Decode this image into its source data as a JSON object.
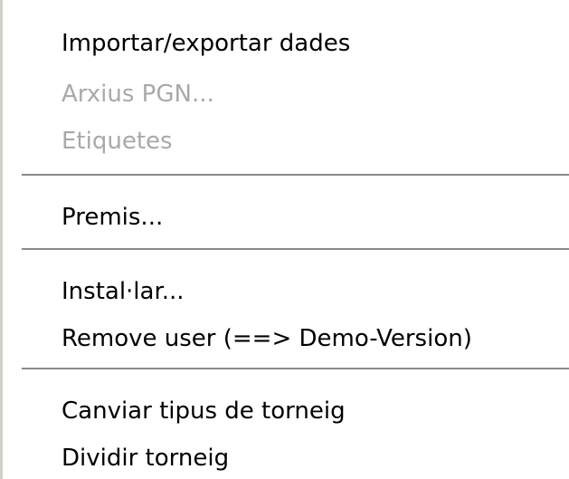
{
  "menu": {
    "items": [
      {
        "label": "Importar/exportar dades",
        "enabled": true
      },
      {
        "label": "Arxius PGN...",
        "enabled": false
      },
      {
        "label": "Etiquetes",
        "enabled": false
      },
      {
        "label": "Premis...",
        "enabled": true
      },
      {
        "label": "Instal·lar...",
        "enabled": true
      },
      {
        "label": "Remove user (==> Demo-Version)",
        "enabled": true
      },
      {
        "label": "Canviar tipus de torneig",
        "enabled": true
      },
      {
        "label": "Dividir torneig",
        "enabled": true
      }
    ]
  }
}
